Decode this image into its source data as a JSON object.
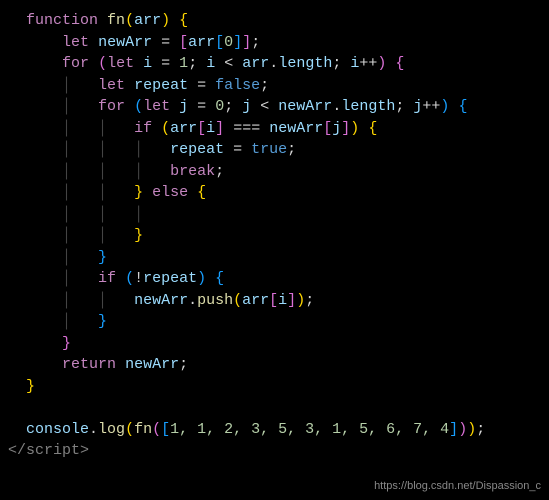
{
  "code": {
    "kw_function": "function",
    "fn_name": "fn",
    "param": "arr",
    "kw_let": "let",
    "id_newArr": "newArr",
    "id_arr": "arr",
    "num_0": "0",
    "kw_for": "for",
    "id_i": "i",
    "num_1": "1",
    "op_lt": "<",
    "prop_length": "length",
    "op_pp": "++",
    "id_repeat": "repeat",
    "bool_false": "false",
    "id_j": "j",
    "kw_if": "if",
    "op_eqeqeq": "===",
    "bool_true": "true",
    "kw_break": "break",
    "kw_else": "else",
    "op_not": "!",
    "fn_push": "push",
    "kw_return": "return",
    "id_console": "console",
    "fn_log": "log",
    "arr_literal": "1, 1, 2, 3, 5, 3, 1, 5, 6, 7, 4",
    "close_tag": "</script>"
  },
  "watermark": "https://blog.csdn.net/Dispassion_c"
}
